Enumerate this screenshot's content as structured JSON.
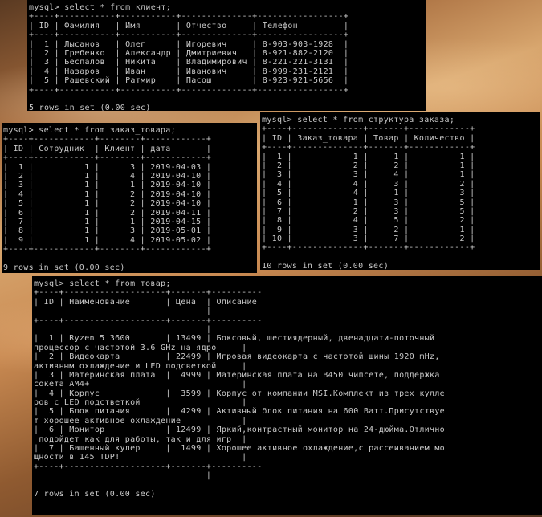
{
  "windows": [
    {
      "command": "mysql> select * from клиент;",
      "lines": [
        "+----+-----------+-----------+--------------+-----------------+",
        "| ID | Фамилия   | Имя       | Отчество     | Телефон         |",
        "+----+-----------+-----------+--------------+-----------------+",
        "|  1 | Лысанов   | Олег      | Игоревич     | 8-903-903-1928  |",
        "|  2 | Гребенко  | Александр | Дмитриевич   | 8-921-882-2120  |",
        "|  3 | Беспалов  | Никита    | Владимирович | 8-221-221-3131  |",
        "|  4 | Назаров   | Иван      | Иванович     | 8-999-231-2121  |",
        "|  5 | Рашевский | Ратмир    | Пасош        | 8-923-921-5656  |",
        "+----+-----------+-----------+--------------+-----------------+"
      ],
      "footer": "5 rows in set (0.00 sec)"
    },
    {
      "command": "mysql> select * from заказ_товара;",
      "lines": [
        "+----+------------+--------+------------+",
        "| ID | Сотрудник  | Клиент | дата       |",
        "+----+------------+--------+------------+",
        "|  1 |          1 |      3 | 2019-04-03 |",
        "|  2 |          1 |      4 | 2019-04-10 |",
        "|  3 |          1 |      1 | 2019-04-10 |",
        "|  4 |          1 |      2 | 2019-04-10 |",
        "|  5 |          1 |      2 | 2019-04-10 |",
        "|  6 |          1 |      2 | 2019-04-11 |",
        "|  7 |          1 |      1 | 2019-04-15 |",
        "|  8 |          1 |      3 | 2019-05-01 |",
        "|  9 |          1 |      4 | 2019-05-02 |",
        "+----+------------+--------+------------+"
      ],
      "footer": "9 rows in set (0.00 sec)"
    },
    {
      "command": "mysql> select * from структура_заказа;",
      "lines": [
        "+----+--------------+-------+------------+",
        "| ID | Заказ_товара | Товар | Количество |",
        "+----+--------------+-------+------------+",
        "|  1 |            1 |     1 |          1 |",
        "|  2 |            2 |     2 |          1 |",
        "|  3 |            3 |     4 |          1 |",
        "|  4 |            4 |     3 |          2 |",
        "|  5 |            4 |     1 |          3 |",
        "|  6 |            1 |     3 |          5 |",
        "|  7 |            2 |     3 |          5 |",
        "|  8 |            4 |     5 |          2 |",
        "|  9 |            3 |     2 |          1 |",
        "| 10 |            3 |     7 |          2 |",
        "+----+--------------+-------+------------+"
      ],
      "footer": "10 rows in set (0.00 sec)"
    },
    {
      "command": "mysql> select * from товар;",
      "lines": [
        "+----+--------------------+-------+----------",
        "| ID | Наименование       | Цена  | Описание",
        "                                  |",
        "+----+--------------------+-------+----------",
        "                                  |",
        "|  1 | Ryzen 5 3600       | 13499 | Боксовый, шестиядерный, двенадцати-поточный",
        "процессор с частотой 3.6 GHz на ядро     |",
        "|  2 | Видеокарта         | 22499 | Игровая видеокарта с частотой шины 1920 mHz,",
        "активным охлаждение и LED подсветкой     |",
        "|  3 | Материнская плата  |  4999 | Материнская плата на B450 чипсете, поддержка",
        "сокета AM4+                              |",
        "|  4 | Корпус             |  3599 | Корпус от компании MSI.Комплект из трех кулле",
        "ров с LED подстветкой                    |",
        "|  5 | Блок питания       |  4299 | Активный блок питания на 600 Ватт.Присутствуе",
        "т хорошее активное охлаждение            |",
        "|  6 | Монитор            | 12499 | Яркий,контрастный монитор на 24-дюйма.Отлично",
        " подойдет как для работы, так и для игр! |",
        "|  7 | Башенный кулер     |  1499 | Хорошее активное охлаждение,с рассеиванием мо",
        "щности в 145 TDP!                        |",
        "+----+--------------------+-------+----------",
        "                                  |"
      ],
      "footer": "7 rows in set (0.00 sec)"
    }
  ]
}
